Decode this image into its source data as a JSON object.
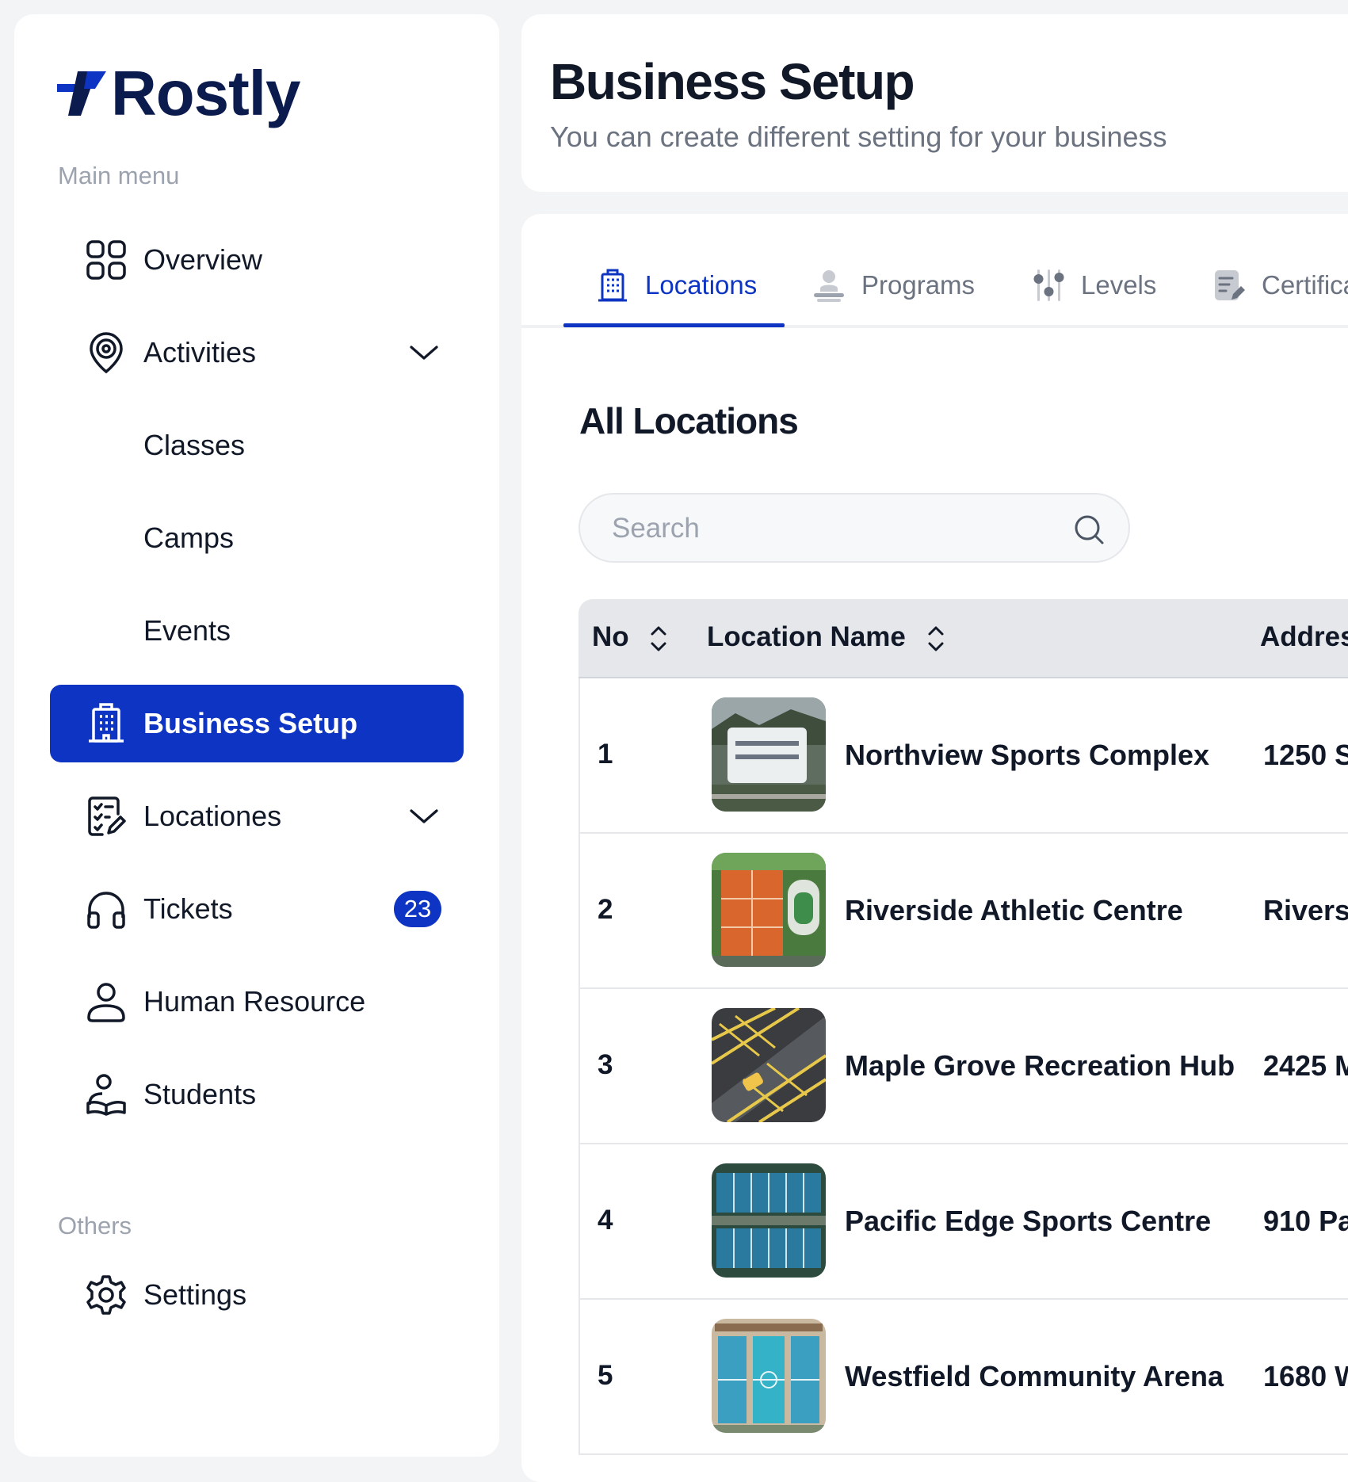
{
  "brand": {
    "name": "Rostly",
    "color": "#0b1b4d",
    "accent": "#0d34c2"
  },
  "sidebar": {
    "main_menu_label": "Main menu",
    "others_label": "Others",
    "items": [
      {
        "label": "Overview",
        "icon": "grid-icon"
      },
      {
        "label": "Activities",
        "icon": "target-pin-icon",
        "expanded": true
      },
      {
        "label": "Classes"
      },
      {
        "label": "Camps"
      },
      {
        "label": "Events"
      },
      {
        "label": "Business Setup",
        "icon": "building-icon",
        "active": true
      },
      {
        "label": "Locationes",
        "icon": "checklist-icon"
      },
      {
        "label": "Tickets",
        "icon": "headphones-icon",
        "badge": "23"
      },
      {
        "label": "Human Resource",
        "icon": "user-icon"
      },
      {
        "label": "Students",
        "icon": "students-icon"
      }
    ],
    "others": [
      {
        "label": "Settings",
        "icon": "gear-icon"
      }
    ]
  },
  "header": {
    "title": "Business Setup",
    "subtitle": "You can create different setting for your business"
  },
  "tabs": [
    {
      "label": "Locations",
      "icon": "building-icon",
      "active": true
    },
    {
      "label": "Programs",
      "icon": "programs-icon"
    },
    {
      "label": "Levels",
      "icon": "levels-icon"
    },
    {
      "label": "Certificates",
      "icon": "certificate-icon"
    }
  ],
  "locations": {
    "title": "All Locations",
    "search_placeholder": "Search",
    "columns": {
      "no": "No",
      "name": "Location Name",
      "address": "Address"
    },
    "rows": [
      {
        "no": "1",
        "name": "Northview Sports Complex",
        "address": "1250 S"
      },
      {
        "no": "2",
        "name": "Riverside Athletic Centre",
        "address": "Rivers"
      },
      {
        "no": "3",
        "name": "Maple Grove Recreation Hub",
        "address": "2425 M"
      },
      {
        "no": "4",
        "name": "Pacific Edge Sports Centre",
        "address": "910 Pa"
      },
      {
        "no": "5",
        "name": "Westfield Community Arena",
        "address": "1680 W"
      }
    ]
  }
}
